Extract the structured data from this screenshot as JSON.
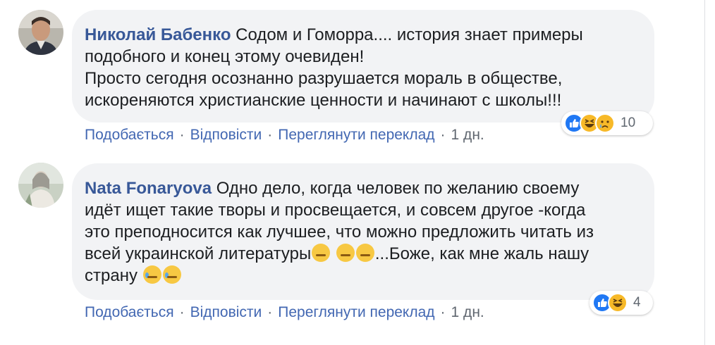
{
  "comments": [
    {
      "author": "Николай Бабенко",
      "lines": [
        "Содом и Гоморра.... история знает примеры",
        "подобного и конец этому очевиден!",
        "Просто сегодня осознанно разрушается мораль в обществе,",
        "искореняются христианские ценности и начинают с школы!!!"
      ],
      "actions": {
        "like": "Подобається",
        "reply": "Відповісти",
        "translate": "Переглянути переклад",
        "time": "1 дн."
      },
      "reactions": {
        "icons": [
          "like-icon",
          "haha-icon",
          "sad-icon"
        ],
        "count": "10"
      }
    },
    {
      "author": "Nata Fonaryova",
      "lines": [
        "Одно дело, когда человек по желанию своему",
        "идёт ищет такие творы и просвещается, и совсем другое -когда",
        "это преподносится как лучшее, что можно предложить читать из",
        "всей украинской литературы",
        "...Боже, как мне жаль нашу",
        "страну"
      ],
      "actions": {
        "like": "Подобається",
        "reply": "Відповісти",
        "translate": "Переглянути переклад",
        "time": "1 дн."
      },
      "reactions": {
        "icons": [
          "like-icon",
          "haha-icon"
        ],
        "count": "4"
      }
    }
  ],
  "colors": {
    "author": "#385898",
    "action": "#4267b2",
    "bubble": "#f2f3f5",
    "meta": "#606770"
  }
}
